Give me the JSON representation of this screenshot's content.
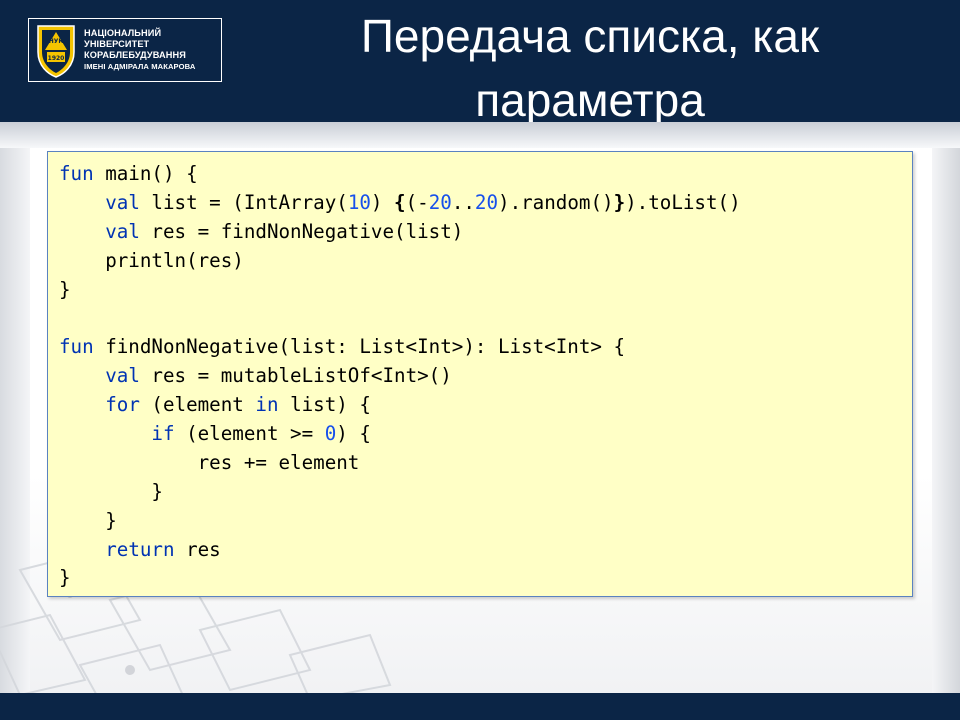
{
  "header": {
    "title_line1": "Передача списка, как",
    "title_line2": "параметра",
    "logo": {
      "line1": "НАЦІОНАЛЬНИЙ",
      "line2": "УНІВЕРСИТЕТ",
      "line3": "КОРАБЛЕБУДУВАННЯ",
      "line4": "ІМЕНІ АДМІРАЛА МАКАРОВА",
      "emblem_text": "НУК",
      "emblem_year": "1920"
    }
  },
  "code": {
    "lines": [
      [
        {
          "t": "fun",
          "c": "kw"
        },
        {
          "t": " main() {"
        }
      ],
      [
        {
          "t": "    "
        },
        {
          "t": "val",
          "c": "kw"
        },
        {
          "t": " list = (IntArray("
        },
        {
          "t": "10",
          "c": "num"
        },
        {
          "t": ") "
        },
        {
          "t": "{",
          "c": "bold"
        },
        {
          "t": "(-"
        },
        {
          "t": "20",
          "c": "num"
        },
        {
          "t": ".."
        },
        {
          "t": "20",
          "c": "num"
        },
        {
          "t": ").random()"
        },
        {
          "t": "}",
          "c": "bold"
        },
        {
          "t": ").toList()"
        }
      ],
      [
        {
          "t": "    "
        },
        {
          "t": "val",
          "c": "kw"
        },
        {
          "t": " res = findNonNegative(list)"
        }
      ],
      [
        {
          "t": "    println(res)"
        }
      ],
      [
        {
          "t": "}"
        }
      ],
      [
        {
          "t": ""
        }
      ],
      [
        {
          "t": "fun",
          "c": "kw"
        },
        {
          "t": " findNonNegative(list: List<Int>): List<Int> {"
        }
      ],
      [
        {
          "t": "    "
        },
        {
          "t": "val",
          "c": "kw"
        },
        {
          "t": " res = mutableListOf<Int>()"
        }
      ],
      [
        {
          "t": "    "
        },
        {
          "t": "for",
          "c": "kw"
        },
        {
          "t": " (element "
        },
        {
          "t": "in",
          "c": "kw"
        },
        {
          "t": " list) {"
        }
      ],
      [
        {
          "t": "        "
        },
        {
          "t": "if",
          "c": "kw"
        },
        {
          "t": " (element >= "
        },
        {
          "t": "0",
          "c": "num"
        },
        {
          "t": ") {"
        }
      ],
      [
        {
          "t": "            res += element"
        }
      ],
      [
        {
          "t": "        }"
        }
      ],
      [
        {
          "t": "    }"
        }
      ],
      [
        {
          "t": "    "
        },
        {
          "t": "return",
          "c": "kw"
        },
        {
          "t": " res"
        }
      ],
      [
        {
          "t": "}"
        }
      ]
    ]
  },
  "colors": {
    "header_bg": "#0b2546",
    "code_bg": "#ffffc6",
    "code_border": "#5a82c0",
    "keyword": "#0033b3",
    "number": "#1750eb"
  }
}
